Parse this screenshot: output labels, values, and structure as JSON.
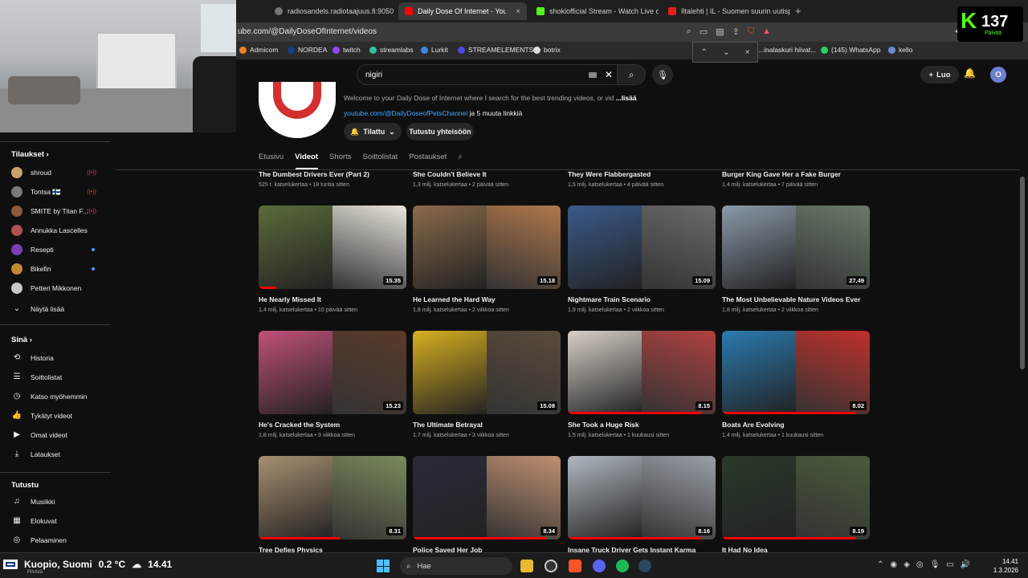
{
  "browser": {
    "tabs": [
      {
        "label": "radiosandels.radiotaajuus.fi:9050",
        "active": false
      },
      {
        "label": "Daily Dose Of Internet - YouTube",
        "active": true
      },
      {
        "label": "shokiofficial Stream - Watch Live on",
        "active": false
      },
      {
        "label": "Iltalehti | IL - Suomen suurin uutispa",
        "active": false
      }
    ],
    "url": "ube.com/@DailyDoseOfInternet/videos",
    "bookmarks": [
      "Admicom",
      "NORDEA",
      "twitch",
      "streamlabs",
      "Lurkit",
      "STREAMELEMENTS",
      "botrix",
      "...inalaskuri hiivat...",
      "(145) WhatsApp",
      "kello"
    ],
    "find_bar": {
      "up": "⌃",
      "down": "⌄",
      "close": "×"
    }
  },
  "kick": {
    "count": "137",
    "sub": "Päivitä"
  },
  "youtube": {
    "search_value": "nigiri",
    "create_label": "Luo",
    "avatar_letter": "O"
  },
  "channel": {
    "description": "Welcome to your Daily Dose of Internet where I search for the best trending videos, or vid",
    "description_more": "...lisää",
    "link": "youtube.com/@DailyDoseofPetsChannel",
    "link_more": "ja 5 muuta linkkiä",
    "subscribe_label": "Tilattu",
    "join_label": "Tutustu yhteisöön",
    "tabs": [
      "Etusivu",
      "Videot",
      "Shorts",
      "Soittolistat",
      "Postaukset"
    ]
  },
  "sidebar": {
    "subs_heading": "Tilaukset",
    "subs": [
      {
        "name": "shroud",
        "color": "#caa36a",
        "badge": "live"
      },
      {
        "name": "Tontsa 🇫🇮",
        "color": "#7a7a7a",
        "badge": "live"
      },
      {
        "name": "SMITE by Titan F...",
        "color": "#8a5a3a",
        "badge": "live"
      },
      {
        "name": "Annukka Lascelles",
        "color": "#b05050",
        "badge": ""
      },
      {
        "name": "Resepti",
        "color": "#7b3fb5",
        "badge": "dot"
      },
      {
        "name": "Bikefin",
        "color": "#c08a30",
        "badge": "dot"
      },
      {
        "name": "Petteri Mikkonen",
        "color": "#c8c8c8",
        "badge": ""
      }
    ],
    "show_more": "Näytä lisää",
    "you_heading": "Sinä",
    "you_items": [
      {
        "label": "Historia",
        "icon": "history-icon",
        "glyph": "⟲"
      },
      {
        "label": "Soittolistat",
        "icon": "playlists-icon",
        "glyph": "☰"
      },
      {
        "label": "Katso myöhemmin",
        "icon": "watch-later-icon",
        "glyph": "◷"
      },
      {
        "label": "Tykätyt videot",
        "icon": "like-icon",
        "glyph": "👍"
      },
      {
        "label": "Omat videot",
        "icon": "your-videos-icon",
        "glyph": "▶"
      },
      {
        "label": "Lataukset",
        "icon": "download-icon",
        "glyph": "⤓"
      }
    ],
    "explore_heading": "Tutustu",
    "explore_items": [
      {
        "label": "Musiikki",
        "icon": "music-icon",
        "glyph": "♫"
      },
      {
        "label": "Elokuvat",
        "icon": "movies-icon",
        "glyph": "▦"
      },
      {
        "label": "Pelaaminen",
        "icon": "gaming-icon",
        "glyph": "◎"
      }
    ]
  },
  "partial_row": [
    {
      "title": "The Dumbest Drivers Ever (Part 2)",
      "meta": "525 t. katselukertaa • 18 tuntia sitten"
    },
    {
      "title": "She Couldn't Believe It",
      "meta": "1,3 milj. katselukertaa • 2 päivää sitten"
    },
    {
      "title": "They Were Flabbergasted",
      "meta": "1,5 milj. katselukertaa • 4 päivää sitten"
    },
    {
      "title": "Burger King Gave Her a Fake Burger",
      "meta": "1,4 milj. katselukertaa • 7 päivää sitten"
    }
  ],
  "videos": [
    {
      "title": "He Nearly Missed It",
      "meta": "1,4 milj. katselukertaa • 10 päivää sitten",
      "duration": "15.35",
      "progress": 0.12,
      "c1": "#5b6b3a",
      "c2": "#e8e4dc"
    },
    {
      "title": "He Learned the Hard Way",
      "meta": "1,8 milj. katselukertaa • 2 viikkoa sitten",
      "duration": "15.18",
      "progress": 0.0,
      "c1": "#8a6a4a",
      "c2": "#b0774a"
    },
    {
      "title": "Nightmare Train Scenario",
      "meta": "1,9 milj. katselukertaa • 2 viikkoa sitten",
      "duration": "15.09",
      "progress": 0.0,
      "c1": "#3a5a8a",
      "c2": "#6a6a6a"
    },
    {
      "title": "The Most Unbelievable Nature Videos Ever",
      "meta": "1,8 milj. katselukertaa • 2 viikkoa sitten",
      "duration": "27.49",
      "progress": 0.0,
      "c1": "#8a9aa8",
      "c2": "#6a7a6a"
    },
    {
      "title": "He's Cracked the System",
      "meta": "1,8 milj. katselukertaa • 3 viikkoa sitten",
      "duration": "15.23",
      "progress": 0.0,
      "c1": "#c0507a",
      "c2": "#5a3a2a"
    },
    {
      "title": "The Ultimate Betrayal",
      "meta": "1,7 milj. katselukertaa • 3 viikkoa sitten",
      "duration": "15.08",
      "progress": 0.0,
      "c1": "#d8b020",
      "c2": "#5a4a3a"
    },
    {
      "title": "She Took a Huge Risk",
      "meta": "1,5 milj. katselukertaa • 1 kuukausi sitten",
      "duration": "8.15",
      "progress": 0.9,
      "c1": "#d8d0c8",
      "c2": "#b04040"
    },
    {
      "title": "Boats Are Evolving",
      "meta": "1,4 milj. katselukertaa • 1 kuukausi sitten",
      "duration": "8.02",
      "progress": 0.9,
      "c1": "#2a7ab0",
      "c2": "#c0302a"
    },
    {
      "title": "Tree Defies Physics",
      "meta": "",
      "duration": "8.31",
      "progress": 0.55,
      "c1": "#a89070",
      "c2": "#7a8a5a"
    },
    {
      "title": "Police Saved Her Job",
      "meta": "",
      "duration": "8.34",
      "progress": 0.9,
      "c1": "#2a2a3a",
      "c2": "#c09070"
    },
    {
      "title": "Insane Truck Driver Gets Instant Karma",
      "meta": "",
      "duration": "8.16",
      "progress": 0.9,
      "c1": "#b0b8c0",
      "c2": "#9aa0a8"
    },
    {
      "title": "It Had No Idea",
      "meta": "",
      "duration": "8.19",
      "progress": 0.9,
      "c1": "#2a3a2a",
      "c2": "#4a5a3a"
    }
  ],
  "taskbar": {
    "weather_city": "Kuopio, Suomi",
    "weather_temp": "0.2 °C",
    "weather_sub": "Pilvistä",
    "weather_time": "14.41",
    "search_label": "Hae",
    "time": "14.41",
    "date": "1.3.2026"
  }
}
